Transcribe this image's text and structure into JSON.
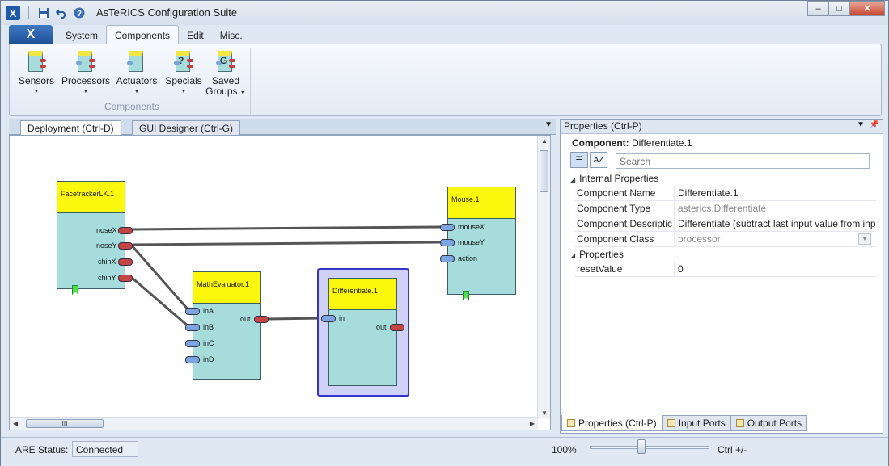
{
  "window": {
    "title": "AsTeRICS Configuration Suite",
    "app_icon_text": "X",
    "quick_access": {
      "save_icon": "save-icon",
      "undo_icon": "undo-icon",
      "help_icon": "help-icon"
    },
    "controls": {
      "minimize": "–",
      "maximize": "□",
      "close": "✕"
    }
  },
  "ribbon": {
    "app_button": "X",
    "tabs": [
      {
        "label": "System"
      },
      {
        "label": "Components"
      },
      {
        "label": "Edit"
      },
      {
        "label": "Misc."
      }
    ],
    "group_label": "Components",
    "buttons": [
      {
        "label": "Sensors",
        "caret": "▼"
      },
      {
        "label": "Processors",
        "caret": "▼"
      },
      {
        "label": "Actuators",
        "caret": "▼"
      },
      {
        "label": "Specials",
        "glyph": "?",
        "caret": "▼"
      },
      {
        "label": "Saved",
        "label2": "Groups",
        "glyph": "G",
        "caret": "▼"
      }
    ]
  },
  "document": {
    "tabs": [
      {
        "label": "Deployment (Ctrl-D)"
      },
      {
        "label": "GUI Designer (Ctrl-G)"
      }
    ],
    "menu_glyph": "▼",
    "scroll_grip": "III",
    "components": [
      {
        "title": "FacetrackerLK.1",
        "outputs": [
          "noseX",
          "noseY",
          "chinX",
          "chinY"
        ]
      },
      {
        "title": "MathEvaluator.1",
        "inputs": [
          "inA",
          "inB",
          "inC",
          "inD"
        ],
        "outputs": [
          "out"
        ]
      },
      {
        "title": "Differentiate.1",
        "inputs": [
          "in"
        ],
        "outputs": [
          "out"
        ]
      },
      {
        "title": "Mouse.1",
        "inputs": [
          "mouseX",
          "mouseY",
          "action"
        ]
      }
    ]
  },
  "properties": {
    "header": "Properties (Ctrl-P)",
    "component_label": "Component:",
    "component_value": "Differentiate.1",
    "search_placeholder": "Search",
    "sort_buttons": {
      "categorized": "☰",
      "alpha": "AZ"
    },
    "sections": [
      {
        "title": "Internal Properties"
      },
      {
        "title": "Properties"
      }
    ],
    "rows": [
      {
        "name": "Component Name",
        "value": "Differentiate.1"
      },
      {
        "name": "Component Type",
        "value": "asterics.Differentiate"
      },
      {
        "name": "Component Descriptic",
        "value": "Differentiate (subtract last input value from inp"
      },
      {
        "name": "Component Class",
        "value": "processor"
      },
      {
        "name": "resetValue",
        "value": "0"
      }
    ],
    "bottom_tabs": [
      {
        "label": "Properties (Ctrl-P)"
      },
      {
        "label": "Input Ports"
      },
      {
        "label": "Output Ports"
      }
    ]
  },
  "status": {
    "are_label": "ARE Status:",
    "are_value": "Connected",
    "zoom": "100%",
    "zoom_level": 0.4,
    "zoom_hint": "Ctrl +/-"
  }
}
